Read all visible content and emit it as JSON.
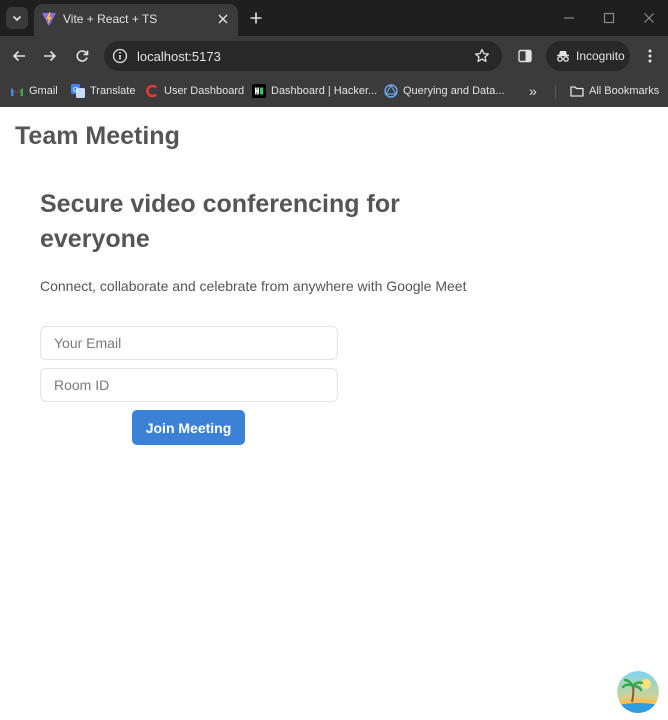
{
  "browser": {
    "tab": {
      "title": "Vite + React + TS"
    },
    "address_bar": {
      "url": "localhost:5173"
    },
    "profile": {
      "label": "Incognito"
    },
    "bookmarks": [
      {
        "label": "Gmail",
        "icon": "gmail-icon"
      },
      {
        "label": "Translate",
        "icon": "translate-icon"
      },
      {
        "label": "User Dashboard",
        "icon": "user-dashboard-icon"
      },
      {
        "label": "Dashboard | Hacker...",
        "icon": "hackerrank-icon"
      },
      {
        "label": "Querying and Data...",
        "icon": "querying-icon"
      }
    ],
    "overflow_label": "»",
    "all_bookmarks": {
      "label": "All Bookmarks",
      "icon": "folder-icon"
    }
  },
  "page": {
    "app_title": "Team Meeting",
    "hero": {
      "heading": "Secure video conferencing for everyone",
      "subtitle": "Connect, collaborate and celebrate from anywhere with Google Meet"
    },
    "form": {
      "email_placeholder": "Your Email",
      "email_value": "",
      "room_placeholder": "Room ID",
      "room_value": "",
      "join_label": "Join Meeting"
    }
  },
  "colors": {
    "chrome_bg": "#1f1f1f",
    "toolbar_bg": "#3b3b3b",
    "text_heading": "#555555",
    "button_bg": "#3b82d6"
  }
}
